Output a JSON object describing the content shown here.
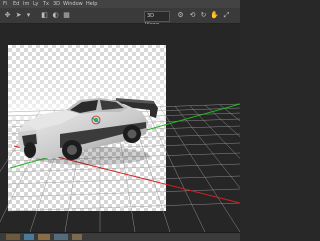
{
  "menu": {
    "items": [
      "Fi",
      "Ed",
      "Im",
      "Ly",
      "Tx",
      "3D",
      "Window",
      "Help"
    ]
  },
  "options_bar": {
    "views_label": "3D Views"
  },
  "colors": {
    "menubar": "#434343",
    "optionsbar": "#3a3a3a",
    "workspace": "#262626",
    "x_axis": "#d42020",
    "y_axis": "#21b821",
    "z_axis": "#2a7bd8"
  },
  "icons": [
    "move-icon",
    "arrow-icon",
    "dropdown-icon",
    "camera-icon",
    "light-icon",
    "grid-icon",
    "settings-icon"
  ]
}
